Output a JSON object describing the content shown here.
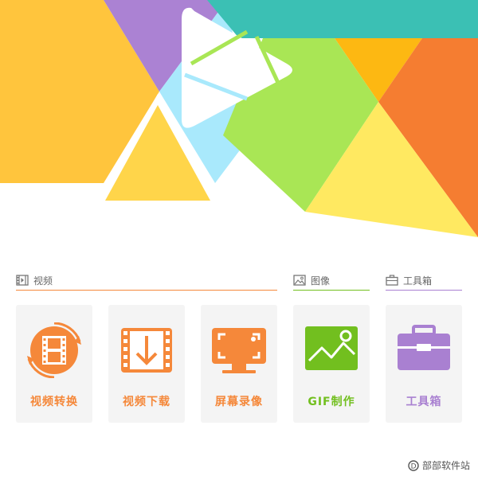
{
  "sections": {
    "video": {
      "label": "视频"
    },
    "image": {
      "label": "图像"
    },
    "toolbox": {
      "label": "工具箱"
    }
  },
  "tools": [
    {
      "label": "视频转换",
      "color": "#f5883a",
      "icon": "video-convert-icon"
    },
    {
      "label": "视频下载",
      "color": "#f5883a",
      "icon": "video-download-icon"
    },
    {
      "label": "屏幕录像",
      "color": "#f5883a",
      "icon": "screen-record-icon"
    },
    {
      "label": "GIF制作",
      "color": "#72bf1f",
      "icon": "gif-make-icon"
    },
    {
      "label": "工具箱",
      "color": "#a980d1",
      "icon": "toolbox-icon"
    }
  ],
  "watermark": {
    "text": "部部软件站"
  },
  "colors": {
    "orange": "#f5883a",
    "green": "#72bf1f",
    "purple": "#a980d1",
    "yellow": "#ffc53d",
    "teal": "#3bc0b4",
    "lime": "#a9e655",
    "sky": "#a8e8fb"
  }
}
